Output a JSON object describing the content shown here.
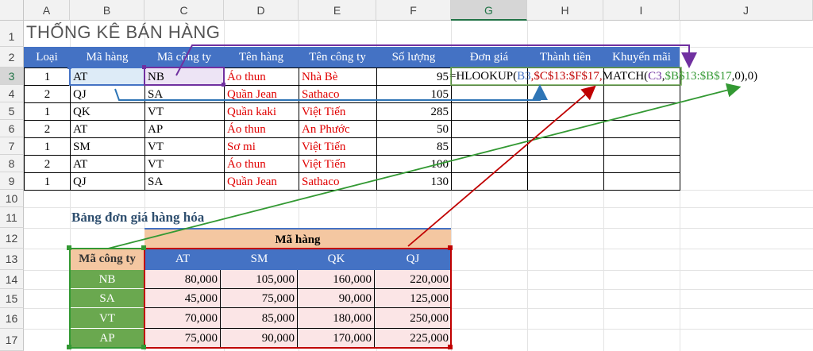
{
  "columns": [
    "A",
    "B",
    "C",
    "D",
    "E",
    "F",
    "G",
    "H",
    "I",
    "J"
  ],
  "selected_column": "G",
  "rows": [
    "1",
    "2",
    "3",
    "4",
    "5",
    "6",
    "7",
    "8",
    "9",
    "10",
    "11",
    "12",
    "13",
    "14",
    "15",
    "16",
    "17"
  ],
  "title": "THỐNG KÊ BÁN HÀNG",
  "main_table": {
    "headers": [
      "Loại",
      "Mã hàng",
      "Mã công ty",
      "Tên hàng",
      "Tên công ty",
      "Số lượng",
      "Đơn giá",
      "Thành tiền",
      "Khuyến mãi"
    ],
    "rows": [
      [
        "1",
        "AT",
        "NB",
        "Áo thun",
        "Nhà Bè",
        "95"
      ],
      [
        "2",
        "QJ",
        "SA",
        "Quần Jean",
        "Sathaco",
        "105"
      ],
      [
        "1",
        "QK",
        "VT",
        "Quần kaki",
        "Việt Tiến",
        "285"
      ],
      [
        "2",
        "AT",
        "AP",
        "Áo thun",
        "An Phước",
        "50"
      ],
      [
        "1",
        "SM",
        "VT",
        "Sơ mi",
        "Việt Tiến",
        "85"
      ],
      [
        "2",
        "AT",
        "VT",
        "Áo thun",
        "Việt Tiến",
        "100"
      ],
      [
        "1",
        "QJ",
        "SA",
        "Quần Jean",
        "Sathaco",
        "130"
      ]
    ]
  },
  "formula": {
    "p1": "=HLOOKUP(",
    "p2": "B3",
    "p3": ",$C$13:$F$17,",
    "p4": "MATCH(",
    "p5": "C3",
    "p6": ",",
    "p7": "$B$13:$B$17",
    "p8": ",0),0)"
  },
  "price_table": {
    "title": "Bảng đơn giá hàng hóa",
    "group_header": "Mã hàng",
    "corner": "Mã công ty",
    "product_codes": [
      "AT",
      "SM",
      "QK",
      "QJ"
    ],
    "rows": [
      {
        "company": "NB",
        "prices": [
          "80,000",
          "105,000",
          "160,000",
          "220,000"
        ]
      },
      {
        "company": "SA",
        "prices": [
          "45,000",
          "75,000",
          "90,000",
          "125,000"
        ]
      },
      {
        "company": "VT",
        "prices": [
          "70,000",
          "85,000",
          "180,000",
          "250,000"
        ]
      },
      {
        "company": "AP",
        "prices": [
          "75,000",
          "90,000",
          "170,000",
          "225,000"
        ]
      }
    ]
  },
  "colors": {
    "header_blue": "#4472c4",
    "price_green": "#6aa84f",
    "price_tan": "#f4c7a1",
    "price_pink": "#fbe5e6",
    "ref_blue": "#4472c4",
    "ref_purple": "#7030a0",
    "ref_green": "#339933",
    "ref_red": "#c00000"
  }
}
